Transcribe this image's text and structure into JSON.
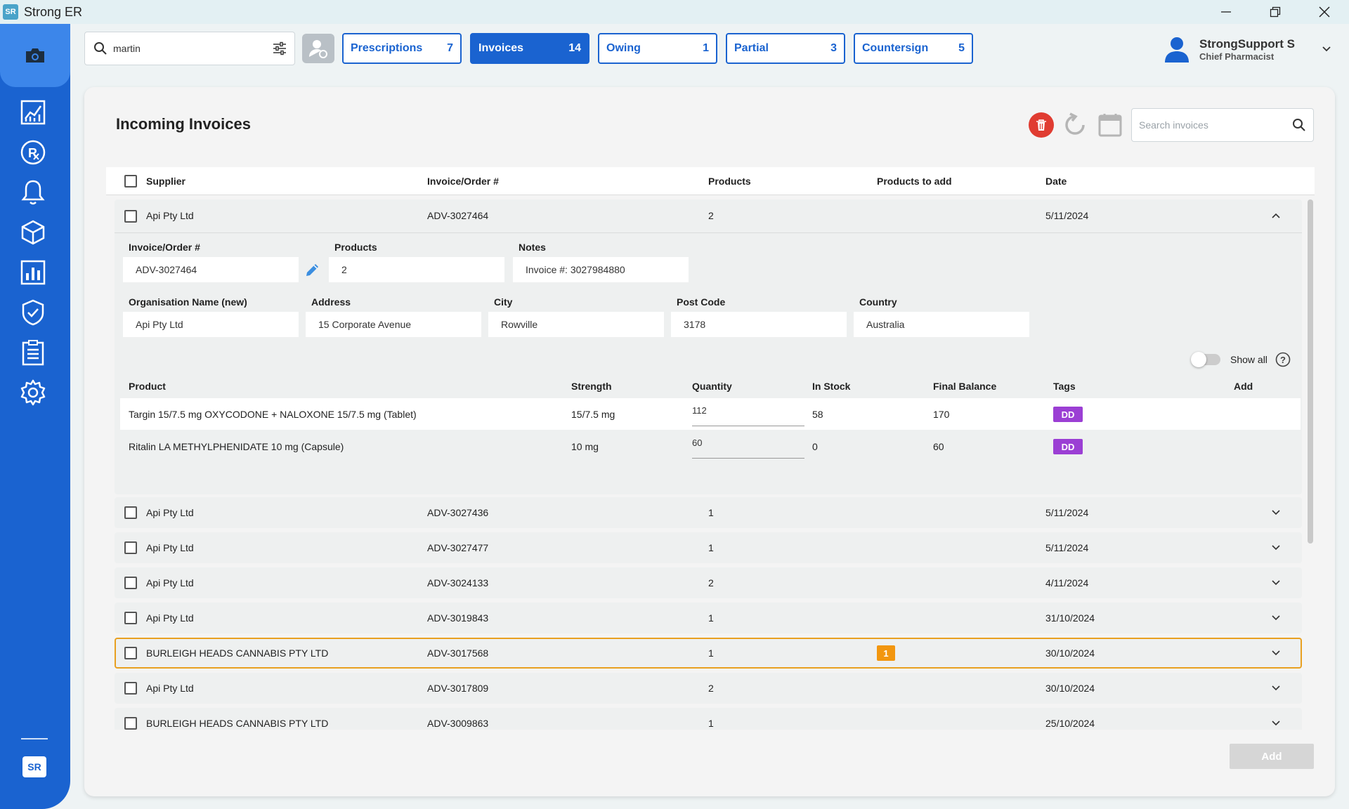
{
  "window": {
    "title": "Strong ER",
    "logo_text": "SR"
  },
  "colors": {
    "primary": "#1a63d0",
    "danger": "#e03c31",
    "tag_dd": "#9b3fd4",
    "highlight": "#e8a020"
  },
  "sidebar": {
    "icons": [
      "camera-icon",
      "chart-icon",
      "rx-icon",
      "bell-icon",
      "box-icon",
      "bar-chart-icon",
      "shield-check-icon",
      "clipboard-icon",
      "gear-icon"
    ],
    "bottom_logo": "SR"
  },
  "top": {
    "search_value": "martin",
    "tabs": [
      {
        "label": "Prescriptions",
        "count": "7"
      },
      {
        "label": "Invoices",
        "count": "14"
      },
      {
        "label": "Owing",
        "count": "1"
      },
      {
        "label": "Partial",
        "count": "3"
      },
      {
        "label": "Countersign",
        "count": "5"
      }
    ],
    "user": {
      "name": "StrongSupport S",
      "role": "Chief Pharmacist"
    }
  },
  "page": {
    "title": "Incoming Invoices",
    "search_placeholder": "Search invoices",
    "add_label": "Add",
    "show_all_label": "Show all"
  },
  "table": {
    "headers": {
      "supplier": "Supplier",
      "invoice": "Invoice/Order #",
      "products": "Products",
      "products_to_add": "Products to add",
      "date": "Date"
    }
  },
  "expanded": {
    "supplier": "Api Pty Ltd",
    "invoice": "ADV-3027464",
    "products": "2",
    "date": "5/11/2024",
    "fields": {
      "invoice_label": "Invoice/Order #",
      "invoice_value": "ADV-3027464",
      "products_label": "Products",
      "products_value": "2",
      "notes_label": "Notes",
      "notes_value": "Invoice #: 3027984880",
      "org_label": "Organisation Name (new)",
      "org_value": "Api Pty Ltd",
      "address_label": "Address",
      "address_value": "15 Corporate Avenue",
      "city_label": "City",
      "city_value": "Rowville",
      "postcode_label": "Post Code",
      "postcode_value": "3178",
      "country_label": "Country",
      "country_value": "Australia"
    },
    "product_headers": {
      "product": "Product",
      "strength": "Strength",
      "quantity": "Quantity",
      "in_stock": "In Stock",
      "final_balance": "Final Balance",
      "tags": "Tags",
      "add": "Add"
    },
    "products_list": [
      {
        "product": "Targin 15/7.5 mg OXYCODONE + NALOXONE 15/7.5 mg (Tablet)",
        "strength": "15/7.5 mg",
        "quantity": "112",
        "in_stock": "58",
        "final_balance": "170",
        "tag": "DD"
      },
      {
        "product": "Ritalin LA METHYLPHENIDATE 10 mg (Capsule)",
        "strength": "10 mg",
        "quantity": "60",
        "in_stock": "0",
        "final_balance": "60",
        "tag": "DD"
      }
    ]
  },
  "rows": [
    {
      "supplier": "Api Pty Ltd",
      "invoice": "ADV-3027436",
      "products": "1",
      "to_add": "",
      "date": "5/11/2024"
    },
    {
      "supplier": "Api Pty Ltd",
      "invoice": "ADV-3027477",
      "products": "1",
      "to_add": "",
      "date": "5/11/2024"
    },
    {
      "supplier": "Api Pty Ltd",
      "invoice": "ADV-3024133",
      "products": "2",
      "to_add": "",
      "date": "4/11/2024"
    },
    {
      "supplier": "Api Pty Ltd",
      "invoice": "ADV-3019843",
      "products": "1",
      "to_add": "",
      "date": "31/10/2024"
    },
    {
      "supplier": "BURLEIGH HEADS CANNABIS PTY LTD",
      "invoice": "ADV-3017568",
      "products": "1",
      "to_add": "1",
      "date": "30/10/2024"
    },
    {
      "supplier": "Api Pty Ltd",
      "invoice": "ADV-3017809",
      "products": "2",
      "to_add": "",
      "date": "30/10/2024"
    },
    {
      "supplier": "BURLEIGH HEADS CANNABIS PTY LTD",
      "invoice": "ADV-3009863",
      "products": "1",
      "to_add": "",
      "date": "25/10/2024"
    }
  ]
}
